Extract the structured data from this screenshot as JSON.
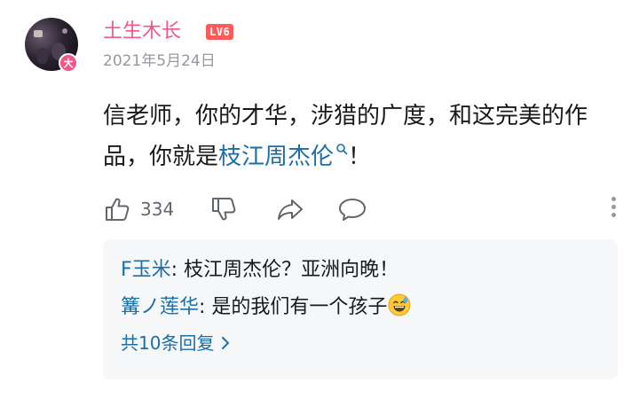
{
  "comment": {
    "avatar_badge": "大",
    "username": "土生木长",
    "level": "LV6",
    "date": "2021年5月24日",
    "content_prefix": "信老师，你的才华，涉猎的广度，和这完美的作品，你就是",
    "content_link": "枝江周杰伦",
    "content_suffix": "！"
  },
  "actions": {
    "like_count": "334",
    "icons": [
      "thumb-up-icon",
      "thumb-down-icon",
      "share-icon",
      "comment-icon",
      "more-vertical-icon"
    ]
  },
  "replies": {
    "items": [
      {
        "name": "F玉米",
        "sep": ": ",
        "text": "枝江周杰伦？亚洲向晚！"
      },
      {
        "name": "篝ノ莲华",
        "sep": ": ",
        "text": "是的我们有一个孩子"
      }
    ],
    "more_label": "共10条回复"
  },
  "colors": {
    "username": "#f0588a",
    "link": "#1a6fa8",
    "level_badge": "#ff5b5b",
    "muted": "#9499a0",
    "reply_bg": "#f6f7f8"
  }
}
